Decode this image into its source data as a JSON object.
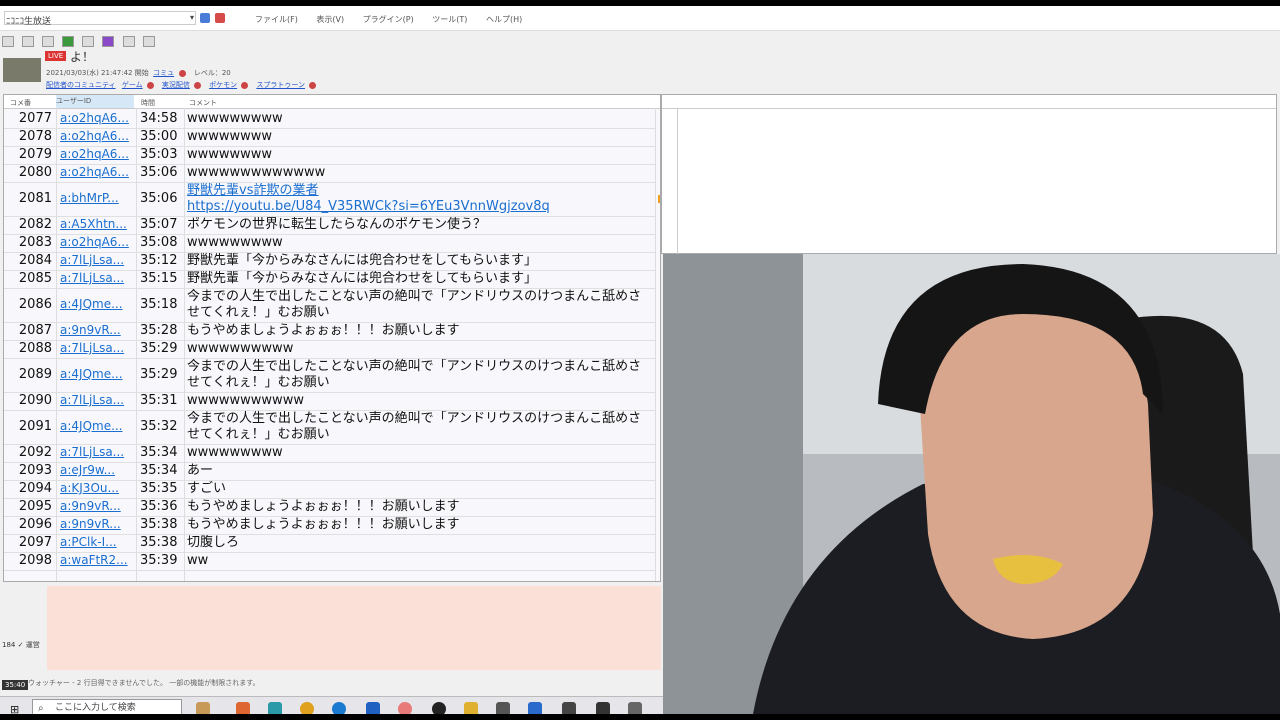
{
  "window": {
    "title": "ﾆｺﾆｺ生放送"
  },
  "menu": [
    "ファイル(F)",
    "表示(V)",
    "プラグイン(P)",
    "ツール(T)",
    "ヘルプ(H)"
  ],
  "broadcast": {
    "badge": "LIVE",
    "title": "よ！",
    "meta": "2021/03/03(水) 21:47:42 開始",
    "community": "コミュ",
    "level": "レベル：20",
    "links": [
      "配信者のコミュニティ",
      "ゲーム",
      "実況配信",
      "ポケモン",
      "スプラトゥーン"
    ]
  },
  "list": {
    "columns": {
      "no": "コメ番",
      "user": "ユーザーID",
      "time": "時間",
      "comment": "コメント"
    },
    "rows": [
      {
        "no": "2077",
        "user": "a:o2hqA6...",
        "time": "34:58",
        "comment": [
          "wwwwwwwww"
        ]
      },
      {
        "no": "2078",
        "user": "a:o2hqA6...",
        "time": "35:00",
        "comment": [
          "wwwwwwww"
        ]
      },
      {
        "no": "2079",
        "user": "a:o2hqA6...",
        "time": "35:03",
        "comment": [
          "wwwwwwww"
        ]
      },
      {
        "no": "2080",
        "user": "a:o2hqA6...",
        "time": "35:06",
        "comment": [
          "wwwwwwwwwwwww"
        ]
      },
      {
        "no": "2081",
        "user": "a:bhMrP...",
        "time": "35:06",
        "comment": [
          "野獣先輩vs詐欺の業者",
          "https://youtu.be/U84_V35RWCk?si=6YEu3VnnWgjzov8q"
        ],
        "link": true
      },
      {
        "no": "2082",
        "user": "a:A5Xhtn...",
        "time": "35:07",
        "comment": [
          "ポケモンの世界に転生したらなんのポケモン使う？"
        ]
      },
      {
        "no": "2083",
        "user": "a:o2hqA6...",
        "time": "35:08",
        "comment": [
          "wwwwwwwww"
        ]
      },
      {
        "no": "2084",
        "user": "a:7lLjLsa...",
        "time": "35:12",
        "comment": [
          "野獣先輩「今からみなさんには兜合わせをしてもらいます」"
        ]
      },
      {
        "no": "2085",
        "user": "a:7lLjLsa...",
        "time": "35:15",
        "comment": [
          "野獣先輩「今からみなさんには兜合わせをしてもらいます」"
        ]
      },
      {
        "no": "2086",
        "user": "a:4JQme...",
        "time": "35:18",
        "comment": [
          "今までの人生で出したことない声の絶叫で「アンドリウスのけつまんこ舐めさ",
          "せてくれぇ！」むお願い"
        ]
      },
      {
        "no": "2087",
        "user": "a:9n9vR...",
        "time": "35:28",
        "comment": [
          "もうやめましょうよぉぉぉ！！！お願いします"
        ]
      },
      {
        "no": "2088",
        "user": "a:7lLjLsa...",
        "time": "35:29",
        "comment": [
          "wwwwwwwwww"
        ]
      },
      {
        "no": "2089",
        "user": "a:4JQme...",
        "time": "35:29",
        "comment": [
          "今までの人生で出したことない声の絶叫で「アンドリウスのけつまんこ舐めさ",
          "せてくれぇ！」むお願い"
        ]
      },
      {
        "no": "2090",
        "user": "a:7lLjLsa...",
        "time": "35:31",
        "comment": [
          "wwwwwwwwwww"
        ]
      },
      {
        "no": "2091",
        "user": "a:4JQme...",
        "time": "35:32",
        "comment": [
          "今までの人生で出したことない声の絶叫で「アンドリウスのけつまんこ舐めさ",
          "せてくれぇ！」むお願い"
        ]
      },
      {
        "no": "2092",
        "user": "a:7lLjLsa...",
        "time": "35:34",
        "comment": [
          "wwwwwwwww"
        ]
      },
      {
        "no": "2093",
        "user": "a:eJr9w...",
        "time": "35:34",
        "comment": [
          "あー"
        ]
      },
      {
        "no": "2094",
        "user": "a:KJ3Ou...",
        "time": "35:35",
        "comment": [
          "すごい"
        ]
      },
      {
        "no": "2095",
        "user": "a:9n9vR...",
        "time": "35:36",
        "comment": [
          "もうやめましょうよぉぉぉ！！！お願いします"
        ]
      },
      {
        "no": "2096",
        "user": "a:9n9vR...",
        "time": "35:38",
        "comment": [
          "もうやめましょうよぉぉぉ！！！お願いします"
        ]
      },
      {
        "no": "2097",
        "user": "a:PClk-I...",
        "time": "35:38",
        "comment": [
          "切腹しろ"
        ]
      },
      {
        "no": "2098",
        "user": "a:waFtR2...",
        "time": "35:39",
        "comment": [
          "ww"
        ]
      }
    ]
  },
  "sidebar_tools": [
    "184",
    "✓",
    "運営"
  ],
  "status_text": "ウォッチャー - 2 行目得できませんでした。 一部の機能が制限されます。",
  "taskbar": {
    "clock": "35:40",
    "search_placeholder": "ここに入力して検索"
  },
  "colors": {
    "accent_link": "#1a6ed0",
    "post_area": "#fbe0d8",
    "live_badge": "#dd3333"
  }
}
